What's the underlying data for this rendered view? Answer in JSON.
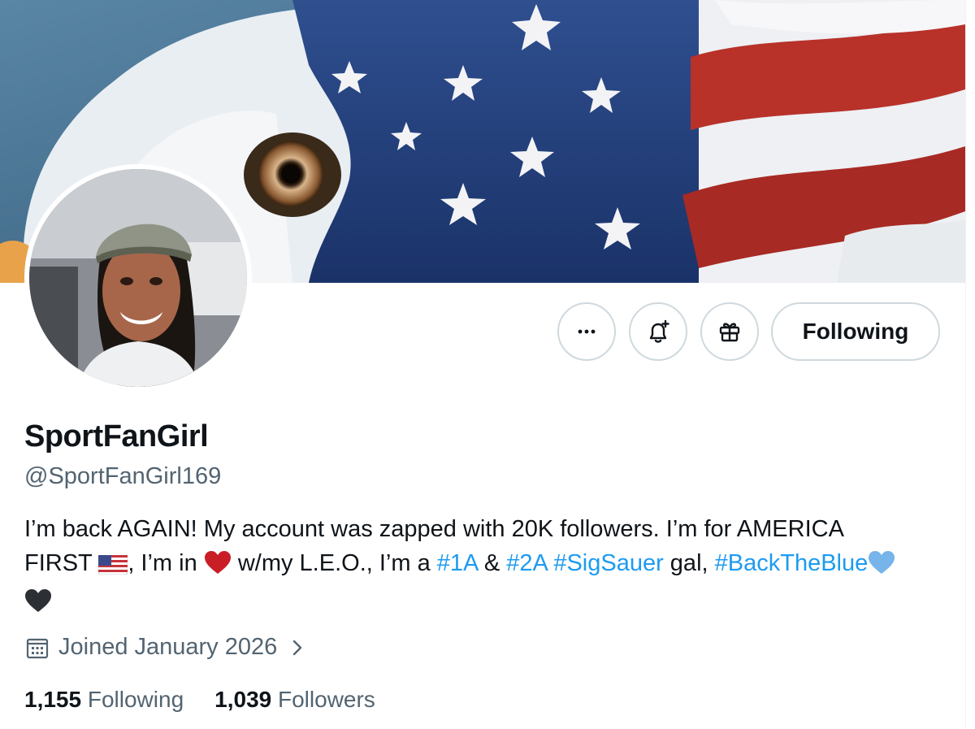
{
  "profile": {
    "display_name": "SportFanGirl",
    "handle": "@SportFanGirl169",
    "bio": {
      "line1": "I’m back AGAIN!  My account was zapped with 20K followers.  I’m for AMERICA",
      "line2_a": "FIRST ",
      "line2_b": ", I’m in ",
      "line2_c": " w/my L.E.O., I’m a ",
      "tag1": "#1A",
      "amp": " & ",
      "tag2": "#2A",
      "tag3": "#SigSauer",
      "line2_d": " gal, ",
      "tag4": "#BackTheBlue"
    },
    "joined": "Joined January 2026",
    "following_count": "1,155",
    "following_label": "Following",
    "followers_count": "1,039",
    "followers_label": "Followers"
  },
  "actions": {
    "more_icon": "more-icon",
    "notify_icon": "bell-plus-icon",
    "gift_icon": "gift-icon",
    "following_button": "Following"
  },
  "colors": {
    "link": "#1d9bf0",
    "secondary_text": "#536471",
    "primary_text": "#0f1419",
    "border": "#cfd9de"
  }
}
